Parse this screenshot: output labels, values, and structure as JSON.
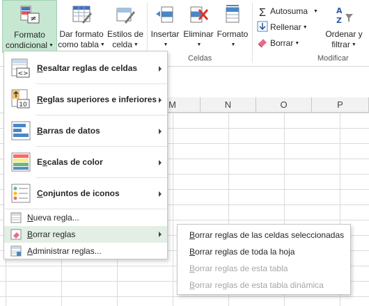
{
  "ribbon": {
    "estilos": {
      "formato_condicional": {
        "line1": "Formato",
        "line2": "condicional"
      },
      "dar_formato_tabla": {
        "line1": "Dar formato",
        "line2": "como tabla"
      },
      "estilos_celda": {
        "line1": "Estilos de",
        "line2": "celda"
      }
    },
    "celdas": {
      "insertar": "Insertar",
      "eliminar": "Eliminar",
      "formato": "Formato",
      "group_label": "Celdas"
    },
    "modificar": {
      "autosuma": "Autosuma",
      "rellenar": "Rellenar",
      "borrar": "Borrar",
      "ordenar_line1": "Ordenar y",
      "ordenar_line2": "filtrar",
      "group_label": "Modificar"
    }
  },
  "sheet": {
    "columns": [
      "M",
      "N",
      "O",
      "P"
    ]
  },
  "menu": {
    "items": [
      {
        "label": "Resaltar reglas de celdas",
        "u": "R",
        "rest": "esaltar reglas de celdas",
        "icon": "highlight-rules-icon"
      },
      {
        "label": "Reglas superiores e inferiores",
        "u": "R",
        "rest": "eglas superiores e inferiores",
        "icon": "top-bottom-rules-icon"
      },
      {
        "label": "Barras de datos",
        "u": "B",
        "rest": "arras de datos",
        "icon": "data-bars-icon"
      },
      {
        "label": "Escalas de color",
        "pre": "E",
        "u": "s",
        "rest": "calas de color",
        "icon": "color-scales-icon"
      },
      {
        "label": "Conjuntos de iconos",
        "u": "C",
        "rest": "onjuntos de iconos",
        "icon": "icon-sets-icon"
      }
    ],
    "small_items": [
      {
        "label": "Nueva regla...",
        "u": "N",
        "rest": "ueva regla...",
        "icon": "new-rule-icon"
      },
      {
        "label": "Borrar reglas",
        "u": "B",
        "rest": "orrar reglas",
        "icon": "clear-rules-icon"
      },
      {
        "label": "Administrar reglas...",
        "u": "A",
        "rest": "dministrar reglas...",
        "icon": "manage-rules-icon"
      }
    ]
  },
  "submenu": {
    "items": [
      {
        "label": "Borrar reglas de las celdas seleccionadas",
        "u": "B",
        "rest": "orrar reglas de las celdas seleccionadas",
        "enabled": true
      },
      {
        "label": "Borrar reglas de toda la hoja",
        "u": "B",
        "rest": "orrar reglas de toda la hoja",
        "enabled": true
      },
      {
        "label": "Borrar reglas de esta tabla",
        "u": "B",
        "rest": "orrar reglas de esta tabla",
        "enabled": false
      },
      {
        "label": "Borrar reglas de esta tabla dinámica",
        "u": "B",
        "rest": "orrar reglas de esta tabla dinámica",
        "enabled": false
      }
    ]
  },
  "colors": {
    "active_button_bg": "#c6e7d2",
    "hover_item_bg": "#e3efe5",
    "disabled_text": "#a6a6a6",
    "excel_green": "#217346"
  }
}
